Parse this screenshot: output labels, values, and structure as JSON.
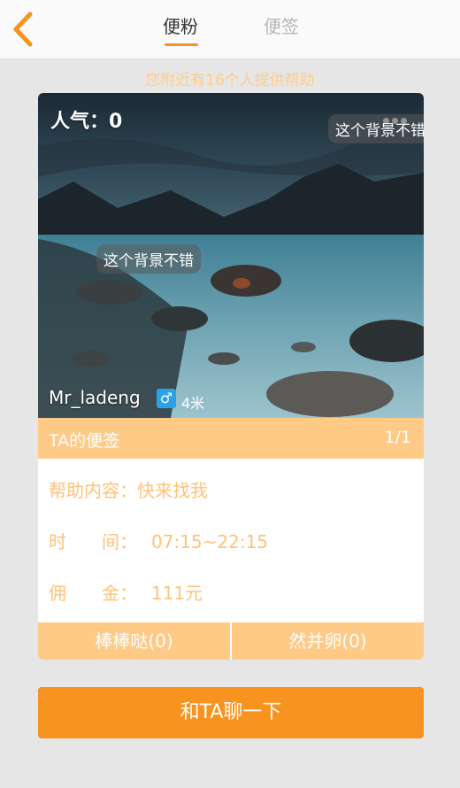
{
  "header": {
    "tabs": [
      {
        "label": "便粉",
        "active": true
      },
      {
        "label": "便签",
        "active": false
      }
    ]
  },
  "nearby_text": "您附近有16个人提供帮助",
  "profile": {
    "popularity": "人气：0",
    "comments": [
      "这个背景不错",
      "这个背景不错"
    ],
    "username": "Mr_ladeng",
    "gender_symbol": "♂",
    "distance": "4米"
  },
  "note": {
    "title": "TA的便签",
    "page": "1/1",
    "help_label": "帮助内容：",
    "help_value": "快来找我",
    "time_label": "时　　间：",
    "time_value": "07:15~22:15",
    "fee_label": "佣　　金：",
    "fee_value": "111元"
  },
  "actions": {
    "like": "棒棒哒(0)",
    "dislike": "然并卵(0)"
  },
  "chat_button": "和TA聊一下",
  "colors": {
    "accent": "#f7931e",
    "light_accent": "#ffca86",
    "text_accent": "#ffc27a",
    "male_badge": "#29a3e8"
  }
}
